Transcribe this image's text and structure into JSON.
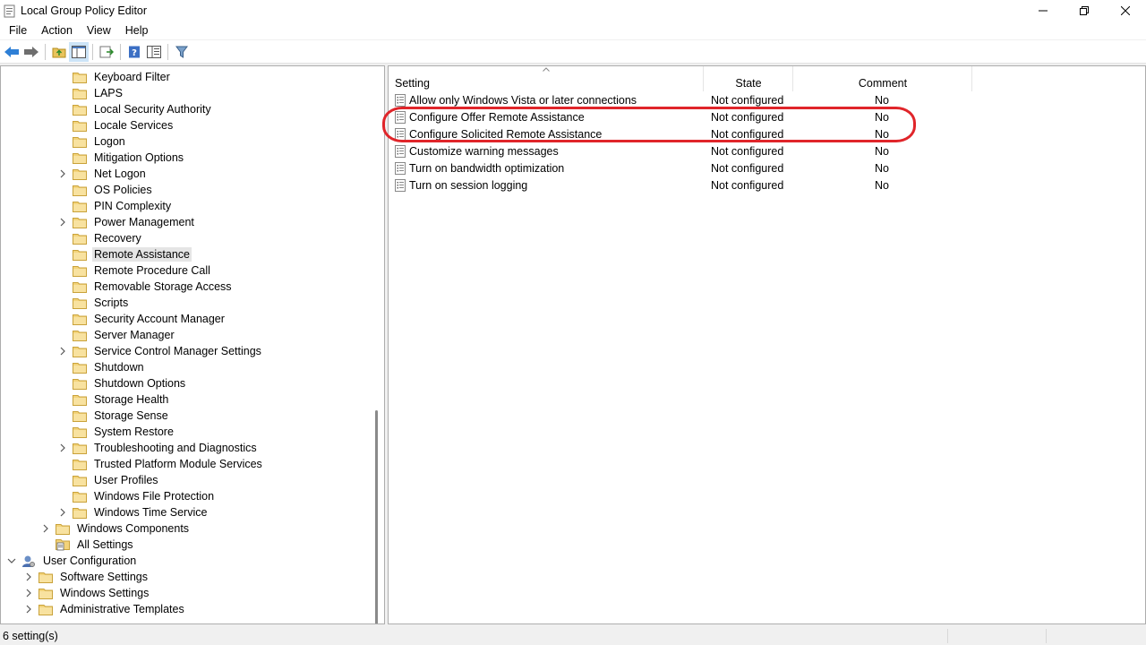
{
  "window": {
    "title": "Local Group Policy Editor"
  },
  "menu": [
    "File",
    "Action",
    "View",
    "Help"
  ],
  "toolbar": {
    "icons": [
      "back-arrow-icon",
      "forward-arrow-icon",
      "up-folder-icon",
      "show-hide-tree-icon",
      "export-list-icon",
      "help-icon",
      "properties-icon",
      "filter-icon"
    ]
  },
  "tree": {
    "items": [
      {
        "label": "Keyboard Filter",
        "expandable": false
      },
      {
        "label": "LAPS",
        "expandable": false
      },
      {
        "label": "Local Security Authority",
        "expandable": false
      },
      {
        "label": "Locale Services",
        "expandable": false
      },
      {
        "label": "Logon",
        "expandable": false
      },
      {
        "label": "Mitigation Options",
        "expandable": false
      },
      {
        "label": "Net Logon",
        "expandable": true
      },
      {
        "label": "OS Policies",
        "expandable": false
      },
      {
        "label": "PIN Complexity",
        "expandable": false
      },
      {
        "label": "Power Management",
        "expandable": true
      },
      {
        "label": "Recovery",
        "expandable": false
      },
      {
        "label": "Remote Assistance",
        "expandable": false,
        "selected": true
      },
      {
        "label": "Remote Procedure Call",
        "expandable": false
      },
      {
        "label": "Removable Storage Access",
        "expandable": false
      },
      {
        "label": "Scripts",
        "expandable": false
      },
      {
        "label": "Security Account Manager",
        "expandable": false
      },
      {
        "label": "Server Manager",
        "expandable": false
      },
      {
        "label": "Service Control Manager Settings",
        "expandable": true
      },
      {
        "label": "Shutdown",
        "expandable": false
      },
      {
        "label": "Shutdown Options",
        "expandable": false
      },
      {
        "label": "Storage Health",
        "expandable": false
      },
      {
        "label": "Storage Sense",
        "expandable": false
      },
      {
        "label": "System Restore",
        "expandable": false
      },
      {
        "label": "Troubleshooting and Diagnostics",
        "expandable": true
      },
      {
        "label": "Trusted Platform Module Services",
        "expandable": false
      },
      {
        "label": "User Profiles",
        "expandable": false
      },
      {
        "label": "Windows File Protection",
        "expandable": false
      },
      {
        "label": "Windows Time Service",
        "expandable": true
      }
    ],
    "windows_components": "Windows Components",
    "all_settings": "All Settings",
    "user_configuration": "User Configuration",
    "user_children": [
      "Software Settings",
      "Windows Settings",
      "Administrative Templates"
    ]
  },
  "list": {
    "columns": {
      "setting": "Setting",
      "state": "State",
      "comment": "Comment"
    },
    "rows": [
      {
        "setting": "Allow only Windows Vista or later connections",
        "state": "Not configured",
        "comment": "No"
      },
      {
        "setting": "Configure Offer Remote Assistance",
        "state": "Not configured",
        "comment": "No"
      },
      {
        "setting": "Configure Solicited Remote Assistance",
        "state": "Not configured",
        "comment": "No"
      },
      {
        "setting": "Customize warning messages",
        "state": "Not configured",
        "comment": "No"
      },
      {
        "setting": "Turn on bandwidth optimization",
        "state": "Not configured",
        "comment": "No"
      },
      {
        "setting": "Turn on session logging",
        "state": "Not configured",
        "comment": "No"
      }
    ],
    "highlight_color": "#e0252a"
  },
  "status": {
    "text": "6 setting(s)"
  }
}
